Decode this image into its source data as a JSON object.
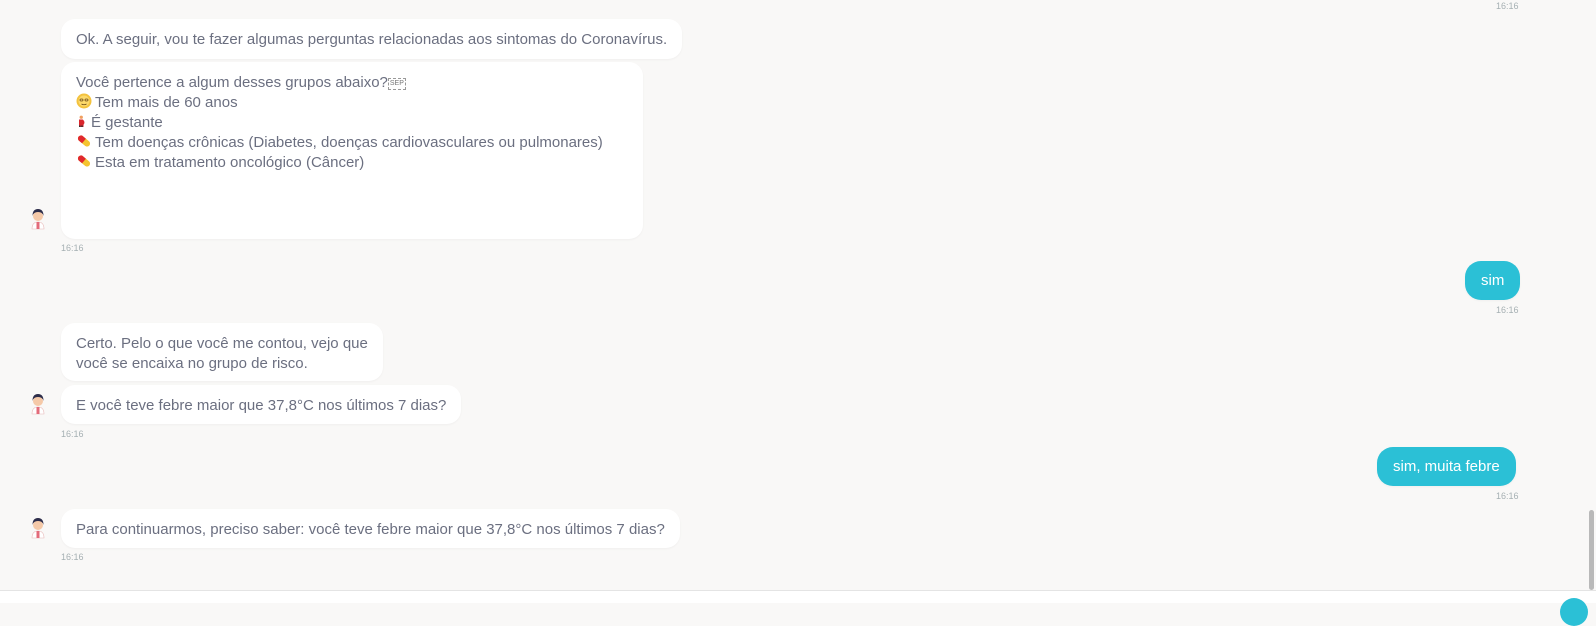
{
  "colors": {
    "background": "#f9f8f7",
    "bot_bubble": "#ffffff",
    "user_bubble": "#2bc0d6",
    "text": "#6b6f80",
    "timestamp": "#a6b0b3"
  },
  "messages": {
    "m0_time": "16:16",
    "m1_text": "Ok. A seguir, vou te fazer algumas perguntas relacionadas aos sintomas do Coronavírus.",
    "m2_line1": "Você pertence a algum desses grupos abaixo?",
    "m2_sep_glyph": "SEP",
    "m2_item1": "Tem mais de 60 anos",
    "m2_item2": "É gestante",
    "m2_item3": "Tem doenças crônicas (Diabetes, doenças cardiovasculares ou pulmonares)",
    "m2_item4": "Esta em tratamento oncológico (Câncer)",
    "m2_time": "16:16",
    "m3_text": "sim",
    "m3_time": "16:16",
    "m4_line1": "Certo. Pelo o que você me contou, vejo que",
    "m4_line2": "você se encaixa no grupo de risco.",
    "m5_text": "E você teve febre maior que 37,8°C nos últimos 7 dias?",
    "m5_time": "16:16",
    "m6_text": "sim, muita febre",
    "m6_time": "16:16",
    "m7_text": "Para continuarmos, preciso saber: você teve febre maior que 37,8°C nos últimos 7 dias?",
    "m7_time": "16:16"
  },
  "icons": {
    "avatar": "bot-avatar-icon",
    "elderly": "elderly-face-icon",
    "pregnant": "pregnant-woman-icon",
    "pill": "pill-icon"
  }
}
